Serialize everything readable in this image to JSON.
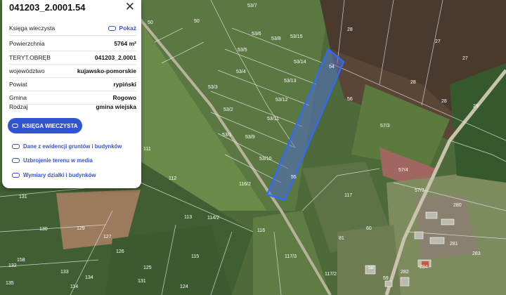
{
  "panel": {
    "title": "041203_2.0001.54",
    "close_icon": "close-icon",
    "rows": [
      {
        "label": "Księga wieczysta",
        "value": "Pokaż"
      },
      {
        "label": "Powierzchnia",
        "value": "5764 m²"
      },
      {
        "label": "TERYT.OBRĘB",
        "value": "041203_2.0001"
      },
      {
        "label": "województwo",
        "value": "kujawsko-pomorskie"
      },
      {
        "label": "Powiat",
        "value": "rypiński"
      },
      {
        "label": "Gmina",
        "value": "Rogowo"
      },
      {
        "label": "Rodzaj",
        "value": "gmina wiejska"
      }
    ],
    "button_label": "KSIĘGA WIECZYSTA",
    "links": [
      "Dane z ewidencji gruntów i budynków",
      "Uzbrojenie terenu w media",
      "Wymiary działki i budynków"
    ]
  },
  "map": {
    "highlight_color": "#2e6bff",
    "parcel_labels": [
      "53/7",
      "50",
      "53/6",
      "53/8",
      "53/15",
      "28",
      "53/5",
      "27",
      "27",
      "53/14",
      "54",
      "53/4",
      "53/13",
      "28",
      "53/3",
      "53/12",
      "56",
      "28",
      "53/2",
      "53/11",
      "57/3",
      "29",
      "53/1",
      "53/9",
      "53/10",
      "111",
      "112",
      "57/4",
      "57/3",
      "55",
      "116/2",
      "131",
      "117",
      "113",
      "114/2",
      "129",
      "127",
      "130",
      "126",
      "116",
      "115",
      "158",
      "133",
      "134",
      "125",
      "132",
      "131",
      "124",
      "117/3",
      "117/2",
      "81",
      "60",
      "58",
      "59",
      "283",
      "284",
      "282",
      "281",
      "280",
      "50",
      "135",
      "114"
    ]
  }
}
